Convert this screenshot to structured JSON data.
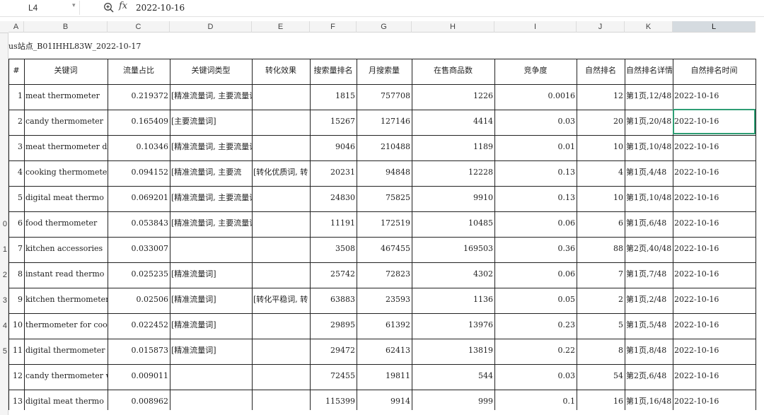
{
  "formula_bar": {
    "cell_ref": "L4",
    "fx_label": "fx",
    "value": "2022-10-16"
  },
  "column_headers": [
    "A",
    "B",
    "C",
    "D",
    "E",
    "F",
    "G",
    "H",
    "I",
    "J",
    "K",
    "L"
  ],
  "row_numbers": [
    "",
    "",
    "",
    "",
    "",
    "",
    "",
    "",
    "",
    "0",
    "1",
    "2",
    "3",
    "4",
    "5"
  ],
  "sheet_title": "us站点_B01IHHL83W_2022-10-17",
  "table": {
    "headers": [
      "#",
      "关键词",
      "流量占比",
      "关键词类型",
      "转化效果",
      "搜索量排名",
      "月搜索量",
      "在售商品数",
      "竞争度",
      "自然排名",
      "自然排名详情",
      "自然排名时间"
    ],
    "rows": [
      [
        "1",
        "meat thermometer",
        "0.219372",
        "[精准流量词, 主要流量词]",
        "",
        "1815",
        "757708",
        "1226",
        "0.0016",
        "12",
        "第1页,12/48",
        "2022-10-16"
      ],
      [
        "2",
        "candy thermometer",
        "0.165409",
        "[主要流量词]",
        "",
        "15267",
        "127146",
        "4414",
        "0.03",
        "20",
        "第1页,20/48",
        "2022-10-16"
      ],
      [
        "3",
        "meat thermometer di",
        "0.10346",
        "[精准流量词, 主要流量词]",
        "",
        "9046",
        "210488",
        "1189",
        "0.01",
        "10",
        "第1页,10/48",
        "2022-10-16"
      ],
      [
        "4",
        "cooking thermometer",
        "0.094152",
        "[精准流量词, 主要流",
        "[转化优质词, 转",
        "20231",
        "94848",
        "12228",
        "0.13",
        "4",
        "第1页,4/48",
        "2022-10-16"
      ],
      [
        "5",
        "digital meat thermo",
        "0.069201",
        "[精准流量词, 主要流量词]",
        "",
        "24830",
        "75825",
        "9910",
        "0.13",
        "10",
        "第1页,10/48",
        "2022-10-16"
      ],
      [
        "6",
        "food thermometer",
        "0.053843",
        "[精准流量词, 主要流量词]",
        "",
        "11191",
        "172519",
        "10485",
        "0.06",
        "6",
        "第1页,6/48",
        "2022-10-16"
      ],
      [
        "7",
        "kitchen accessories",
        "0.033007",
        "",
        "",
        "3508",
        "467455",
        "169503",
        "0.36",
        "88",
        "第2页,40/48",
        "2022-10-16"
      ],
      [
        "8",
        "instant read thermo",
        "0.025235",
        "[精准流量词]",
        "",
        "25742",
        "72823",
        "4302",
        "0.06",
        "7",
        "第1页,7/48",
        "2022-10-16"
      ],
      [
        "9",
        "kitchen thermometer",
        "0.02506",
        "[精准流量词]",
        "[转化平稳词, 转",
        "63883",
        "23593",
        "1136",
        "0.05",
        "2",
        "第1页,2/48",
        "2022-10-16"
      ],
      [
        "10",
        "thermometer for coo",
        "0.022452",
        "[精准流量词]",
        "",
        "29895",
        "61392",
        "13976",
        "0.23",
        "5",
        "第1页,5/48",
        "2022-10-16"
      ],
      [
        "11",
        "digital thermometer",
        "0.015873",
        "[精准流量词]",
        "",
        "29472",
        "62413",
        "13819",
        "0.22",
        "8",
        "第1页,8/48",
        "2022-10-16"
      ],
      [
        "12",
        "candy thermometer w",
        "0.009011",
        "",
        "",
        "72455",
        "19811",
        "544",
        "0.03",
        "54",
        "第2页,6/48",
        "2022-10-16"
      ],
      [
        "13",
        "digital meat thermo",
        "0.008962",
        "",
        "",
        "115399",
        "9914",
        "999",
        "0.1",
        "16",
        "第1页,16/48",
        "2022-10-16"
      ]
    ]
  }
}
